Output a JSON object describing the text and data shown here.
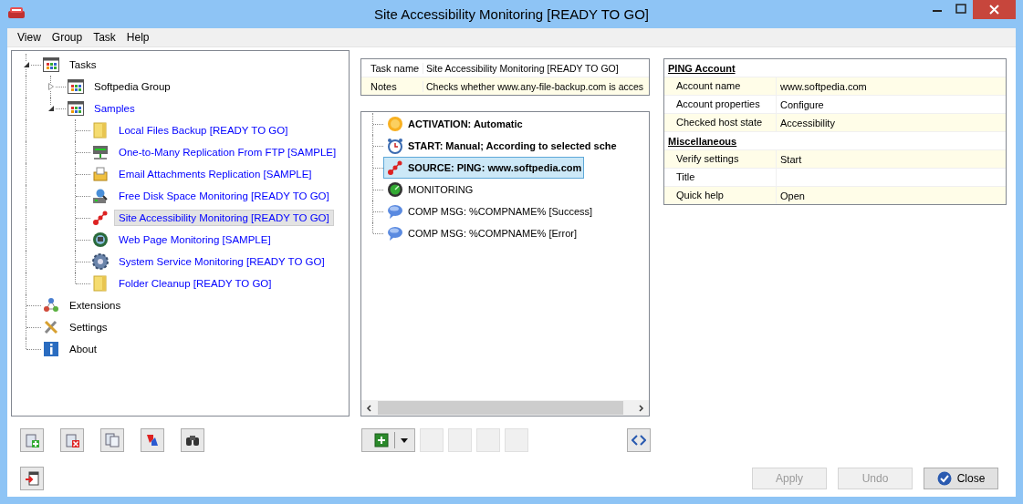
{
  "window": {
    "title": "Site Accessibility Monitoring [READY TO GO]"
  },
  "menu": [
    "View",
    "Group",
    "Task",
    "Help"
  ],
  "tree": [
    {
      "label": "Tasks",
      "kind": "group",
      "color": "#000000",
      "expanded": true,
      "selected": false,
      "children": [
        {
          "label": "Softpedia Group",
          "kind": "group",
          "color": "#000000",
          "expanded": false,
          "selected": false
        },
        {
          "label": "Samples",
          "kind": "group",
          "color": "#0000ff",
          "expanded": true,
          "selected": false,
          "children": [
            {
              "label": "Local Files Backup [READY TO GO]",
              "kind": "folder",
              "color": "#0000ff",
              "selected": false
            },
            {
              "label": "One-to-Many Replication From FTP [SAMPLE]",
              "kind": "ftp",
              "color": "#0000ff",
              "selected": false
            },
            {
              "label": "Email Attachments Replication [SAMPLE]",
              "kind": "mail",
              "color": "#0000ff",
              "selected": false
            },
            {
              "label": "Free Disk Space Monitoring [READY TO GO]",
              "kind": "disk",
              "color": "#0000ff",
              "selected": false
            },
            {
              "label": "Site Accessibility Monitoring [READY TO GO]",
              "kind": "ping",
              "color": "#0000ff",
              "selected": true
            },
            {
              "label": "Web Page Monitoring [SAMPLE]",
              "kind": "web",
              "color": "#0000ff",
              "selected": false
            },
            {
              "label": "System Service Monitoring [READY TO GO]",
              "kind": "gear",
              "color": "#0000ff",
              "selected": false
            },
            {
              "label": "Folder Cleanup [READY TO GO]",
              "kind": "folder",
              "color": "#0000ff",
              "selected": false
            }
          ]
        }
      ]
    },
    {
      "label": "Extensions",
      "kind": "extensions",
      "color": "#000000",
      "selected": false
    },
    {
      "label": "Settings",
      "kind": "settings",
      "color": "#000000",
      "selected": false
    },
    {
      "label": "About",
      "kind": "about",
      "color": "#000000",
      "selected": false
    }
  ],
  "task_info": [
    {
      "label": "Task name",
      "value": "Site Accessibility Monitoring [READY TO GO]"
    },
    {
      "label": "Notes",
      "value": "Checks whether www.any-file-backup.com is acces"
    }
  ],
  "steps": [
    {
      "text": "ACTIVATION: Automatic",
      "kind": "activation",
      "bold": true,
      "selected": false
    },
    {
      "text": "START: Manual; According to selected sche",
      "kind": "start",
      "bold": true,
      "selected": false
    },
    {
      "text": "SOURCE: PING: www.softpedia.com",
      "kind": "ping",
      "bold": true,
      "selected": true
    },
    {
      "text": "MONITORING",
      "kind": "monitoring",
      "bold": false,
      "selected": false
    },
    {
      "text": "COMP MSG: %COMPNAME% [Success]",
      "kind": "message",
      "bold": false,
      "selected": false
    },
    {
      "text": "COMP MSG: %COMPNAME% [Error]",
      "kind": "message",
      "bold": false,
      "selected": false
    }
  ],
  "properties": [
    {
      "title": "PING Account",
      "rows": [
        {
          "name": "Account name",
          "value": "www.softpedia.com"
        },
        {
          "name": "Account properties",
          "value": "Configure"
        },
        {
          "name": "Checked host state",
          "value": "Accessibility"
        }
      ]
    },
    {
      "title": "Miscellaneous",
      "rows": [
        {
          "name": "Verify settings",
          "value": "Start"
        },
        {
          "name": "Title"
        },
        {
          "name": "Quick help",
          "value": "Open"
        }
      ]
    }
  ],
  "footer_buttons": [
    {
      "label": "Apply",
      "disabled": true,
      "kind": "plain"
    },
    {
      "label": "Undo",
      "disabled": true,
      "kind": "plain"
    },
    {
      "label": "Close",
      "disabled": false,
      "kind": "close"
    }
  ]
}
